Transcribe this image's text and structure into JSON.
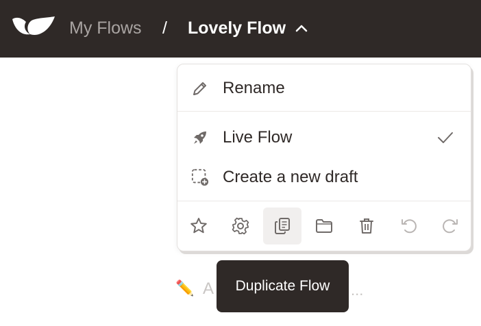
{
  "header": {
    "breadcrumb_root": "My Flows",
    "separator": "/",
    "current_flow": "Lovely Flow"
  },
  "menu": {
    "rename": "Rename",
    "live_flow": "Live Flow",
    "create_draft": "Create a new draft",
    "live_flow_selected": true,
    "toolbar_icons": [
      "star-icon",
      "gear-icon",
      "copy-icon",
      "folder-icon",
      "trash-icon",
      "undo-icon",
      "redo-icon"
    ]
  },
  "tooltip": {
    "text": "Duplicate Flow"
  },
  "background": {
    "placeholder_start": "A",
    "placeholder_end": "..."
  },
  "colors": {
    "topbar": "#2f2927",
    "icon_gray": "#6f6a68",
    "icon_disabled": "#b9b5b3",
    "active_button_bg": "#f1efee"
  }
}
